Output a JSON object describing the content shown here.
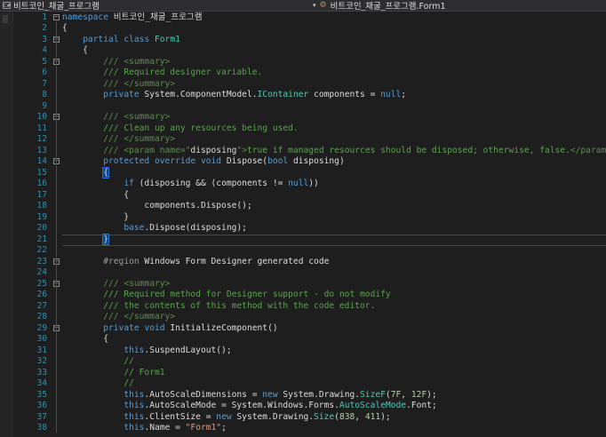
{
  "navbar": {
    "project_icon": "C#",
    "project": "비트코인_채굴_프로그램",
    "member_icon": "class-icon",
    "member": "비트코인_채굴_프로그램.Form1"
  },
  "colors": {
    "background": "#1e1e1e",
    "line_number": "#2b91af",
    "keyword": "#569cd6",
    "comment": "#57a64a",
    "type": "#4ec9b0",
    "string": "#d69d85",
    "number": "#b5cea8"
  },
  "lines": [
    {
      "n": "1",
      "fold": "minus",
      "tokens": [
        {
          "c": "kw",
          "t": "namespace"
        },
        {
          "c": "tx",
          "t": " 비트코인_채굴_프로그램"
        }
      ]
    },
    {
      "n": "2",
      "tokens": [
        {
          "c": "tx",
          "t": "{"
        }
      ]
    },
    {
      "n": "3",
      "fold": "minus",
      "tokens": [
        {
          "c": "tx",
          "t": "    "
        },
        {
          "c": "kw",
          "t": "partial"
        },
        {
          "c": "tx",
          "t": " "
        },
        {
          "c": "kw",
          "t": "class"
        },
        {
          "c": "tx",
          "t": " "
        },
        {
          "c": "ty",
          "t": "Form1"
        }
      ]
    },
    {
      "n": "4",
      "tokens": [
        {
          "c": "tx",
          "t": "    {"
        }
      ]
    },
    {
      "n": "5",
      "fold": "minus",
      "tokens": [
        {
          "c": "tx",
          "t": "        "
        },
        {
          "c": "xd",
          "t": "/// <summary>"
        }
      ]
    },
    {
      "n": "6",
      "tokens": [
        {
          "c": "tx",
          "t": "        "
        },
        {
          "c": "cm",
          "t": "/// Required designer variable."
        }
      ]
    },
    {
      "n": "7",
      "tokens": [
        {
          "c": "tx",
          "t": "        "
        },
        {
          "c": "xd",
          "t": "/// </summary>"
        }
      ]
    },
    {
      "n": "8",
      "tokens": [
        {
          "c": "tx",
          "t": "        "
        },
        {
          "c": "kw",
          "t": "private"
        },
        {
          "c": "tx",
          "t": " System.ComponentModel."
        },
        {
          "c": "ty",
          "t": "IContainer"
        },
        {
          "c": "tx",
          "t": " components = "
        },
        {
          "c": "kw",
          "t": "null"
        },
        {
          "c": "tx",
          "t": ";"
        }
      ]
    },
    {
      "n": "9",
      "tokens": []
    },
    {
      "n": "10",
      "fold": "minus",
      "tokens": [
        {
          "c": "tx",
          "t": "        "
        },
        {
          "c": "xd",
          "t": "/// <summary>"
        }
      ]
    },
    {
      "n": "11",
      "tokens": [
        {
          "c": "tx",
          "t": "        "
        },
        {
          "c": "cm",
          "t": "/// Clean up any resources being used."
        }
      ]
    },
    {
      "n": "12",
      "tokens": [
        {
          "c": "tx",
          "t": "        "
        },
        {
          "c": "xd",
          "t": "/// </summary>"
        }
      ]
    },
    {
      "n": "13",
      "tokens": [
        {
          "c": "tx",
          "t": "        "
        },
        {
          "c": "xd",
          "t": "/// <param name=\""
        },
        {
          "c": "tx",
          "t": "disposing"
        },
        {
          "c": "xd",
          "t": "\">"
        },
        {
          "c": "cm",
          "t": "true if managed resources should be disposed; otherwise, false."
        },
        {
          "c": "xd",
          "t": "</param>"
        }
      ]
    },
    {
      "n": "14",
      "fold": "minus",
      "tokens": [
        {
          "c": "tx",
          "t": "        "
        },
        {
          "c": "kw",
          "t": "protected"
        },
        {
          "c": "tx",
          "t": " "
        },
        {
          "c": "kw",
          "t": "override"
        },
        {
          "c": "tx",
          "t": " "
        },
        {
          "c": "kw",
          "t": "void"
        },
        {
          "c": "tx",
          "t": " Dispose("
        },
        {
          "c": "kw",
          "t": "bool"
        },
        {
          "c": "tx",
          "t": " disposing)"
        }
      ]
    },
    {
      "n": "15",
      "tokens": [
        {
          "c": "tx",
          "t": "        "
        },
        {
          "c": "tx",
          "t": "{",
          "hl": true
        }
      ]
    },
    {
      "n": "16",
      "tokens": [
        {
          "c": "tx",
          "t": "            "
        },
        {
          "c": "kw",
          "t": "if"
        },
        {
          "c": "tx",
          "t": " (disposing && (components != "
        },
        {
          "c": "kw",
          "t": "null"
        },
        {
          "c": "tx",
          "t": "))"
        }
      ]
    },
    {
      "n": "17",
      "tokens": [
        {
          "c": "tx",
          "t": "            {"
        }
      ]
    },
    {
      "n": "18",
      "tokens": [
        {
          "c": "tx",
          "t": "                components.Dispose();"
        }
      ]
    },
    {
      "n": "19",
      "tokens": [
        {
          "c": "tx",
          "t": "            }"
        }
      ]
    },
    {
      "n": "20",
      "tokens": [
        {
          "c": "tx",
          "t": "            "
        },
        {
          "c": "kw",
          "t": "base"
        },
        {
          "c": "tx",
          "t": ".Dispose(disposing);"
        }
      ]
    },
    {
      "n": "21",
      "current": true,
      "tokens": [
        {
          "c": "tx",
          "t": "        "
        },
        {
          "c": "tx",
          "t": "}",
          "hl": true
        }
      ]
    },
    {
      "n": "22",
      "tokens": []
    },
    {
      "n": "23",
      "fold": "minus",
      "tokens": [
        {
          "c": "tx",
          "t": "        "
        },
        {
          "c": "pp",
          "t": "#region"
        },
        {
          "c": "tx",
          "t": " Windows Form Designer generated code"
        }
      ]
    },
    {
      "n": "24",
      "tokens": []
    },
    {
      "n": "25",
      "fold": "minus",
      "tokens": [
        {
          "c": "tx",
          "t": "        "
        },
        {
          "c": "xd",
          "t": "/// <summary>"
        }
      ]
    },
    {
      "n": "26",
      "tokens": [
        {
          "c": "tx",
          "t": "        "
        },
        {
          "c": "cm",
          "t": "/// Required method for Designer support - do not modify"
        }
      ]
    },
    {
      "n": "27",
      "tokens": [
        {
          "c": "tx",
          "t": "        "
        },
        {
          "c": "cm",
          "t": "/// the contents of this method with the code editor."
        }
      ]
    },
    {
      "n": "28",
      "tokens": [
        {
          "c": "tx",
          "t": "        "
        },
        {
          "c": "xd",
          "t": "/// </summary>"
        }
      ]
    },
    {
      "n": "29",
      "fold": "minus",
      "tokens": [
        {
          "c": "tx",
          "t": "        "
        },
        {
          "c": "kw",
          "t": "private"
        },
        {
          "c": "tx",
          "t": " "
        },
        {
          "c": "kw",
          "t": "void"
        },
        {
          "c": "tx",
          "t": " InitializeComponent()"
        }
      ]
    },
    {
      "n": "30",
      "tokens": [
        {
          "c": "tx",
          "t": "        {"
        }
      ]
    },
    {
      "n": "31",
      "tokens": [
        {
          "c": "tx",
          "t": "            "
        },
        {
          "c": "kw",
          "t": "this"
        },
        {
          "c": "tx",
          "t": ".SuspendLayout();"
        }
      ]
    },
    {
      "n": "32",
      "tokens": [
        {
          "c": "tx",
          "t": "            "
        },
        {
          "c": "cm",
          "t": "//"
        }
      ]
    },
    {
      "n": "33",
      "tokens": [
        {
          "c": "tx",
          "t": "            "
        },
        {
          "c": "cm",
          "t": "// Form1"
        }
      ]
    },
    {
      "n": "34",
      "tokens": [
        {
          "c": "tx",
          "t": "            "
        },
        {
          "c": "cm",
          "t": "//"
        }
      ]
    },
    {
      "n": "35",
      "tokens": [
        {
          "c": "tx",
          "t": "            "
        },
        {
          "c": "kw",
          "t": "this"
        },
        {
          "c": "tx",
          "t": ".AutoScaleDimensions = "
        },
        {
          "c": "kw",
          "t": "new"
        },
        {
          "c": "tx",
          "t": " System.Drawing."
        },
        {
          "c": "ty",
          "t": "SizeF"
        },
        {
          "c": "tx",
          "t": "("
        },
        {
          "c": "nm",
          "t": "7F"
        },
        {
          "c": "tx",
          "t": ", "
        },
        {
          "c": "nm",
          "t": "12F"
        },
        {
          "c": "tx",
          "t": ");"
        }
      ]
    },
    {
      "n": "36",
      "tokens": [
        {
          "c": "tx",
          "t": "            "
        },
        {
          "c": "kw",
          "t": "this"
        },
        {
          "c": "tx",
          "t": ".AutoScaleMode = System.Windows.Forms."
        },
        {
          "c": "ty",
          "t": "AutoScaleMode"
        },
        {
          "c": "tx",
          "t": ".Font;"
        }
      ]
    },
    {
      "n": "37",
      "tokens": [
        {
          "c": "tx",
          "t": "            "
        },
        {
          "c": "kw",
          "t": "this"
        },
        {
          "c": "tx",
          "t": ".ClientSize = "
        },
        {
          "c": "kw",
          "t": "new"
        },
        {
          "c": "tx",
          "t": " System.Drawing."
        },
        {
          "c": "ty",
          "t": "Size"
        },
        {
          "c": "tx",
          "t": "("
        },
        {
          "c": "nm",
          "t": "838"
        },
        {
          "c": "tx",
          "t": ", "
        },
        {
          "c": "nm",
          "t": "411"
        },
        {
          "c": "tx",
          "t": ");"
        }
      ]
    },
    {
      "n": "38",
      "tokens": [
        {
          "c": "tx",
          "t": "            "
        },
        {
          "c": "kw",
          "t": "this"
        },
        {
          "c": "tx",
          "t": ".Name = "
        },
        {
          "c": "st",
          "t": "\"Form1\""
        },
        {
          "c": "tx",
          "t": ";"
        }
      ]
    }
  ]
}
